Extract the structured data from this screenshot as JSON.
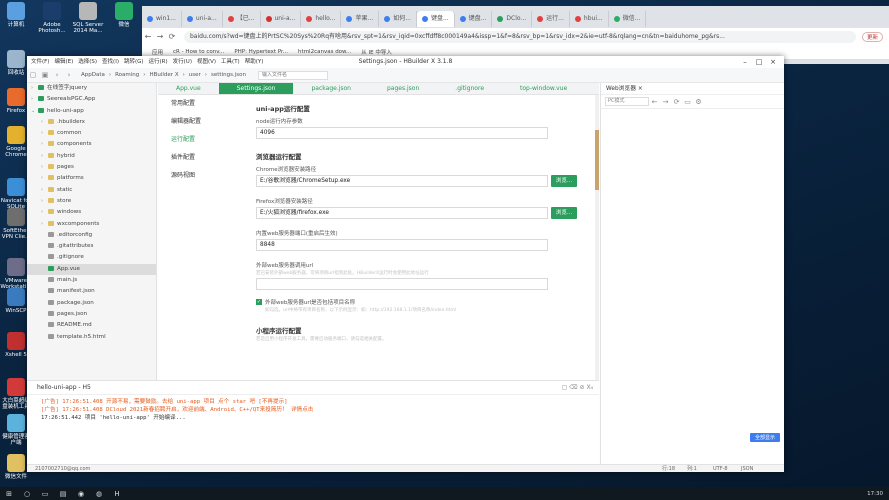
{
  "desktop_icons": [
    {
      "label": "计算机",
      "color": "#5aa0e0"
    },
    {
      "label": "Adobe Photosh...",
      "color": "#1b3d6b"
    },
    {
      "label": "SQL Server 2014 Ma...",
      "color": "#b7b7b7"
    },
    {
      "label": "微信",
      "color": "#2aae67"
    },
    {
      "label": "回收站",
      "color": "#9bb6cc"
    },
    {
      "label": "Firefox",
      "color": "#e86a2c"
    },
    {
      "label": "Google Chrome",
      "color": "#e3b12d"
    },
    {
      "label": "Navicat for SQLite",
      "color": "#3b8fd6"
    },
    {
      "label": "SoftEther VPN Clie...",
      "color": "#6e6e6e"
    },
    {
      "label": "VMware Workstati...",
      "color": "#6d6d8a"
    },
    {
      "label": "WinSCP",
      "color": "#3a7bbf"
    },
    {
      "label": "Xshell 5",
      "color": "#c03030"
    },
    {
      "label": "大白菜超级 盘装机工具",
      "color": "#d23a3a"
    },
    {
      "label": "健康管理客户端",
      "color": "#5bb3dd"
    },
    {
      "label": "微信文件",
      "color": "#e0c060"
    }
  ],
  "browser": {
    "tabs": [
      {
        "label": "win1...",
        "color": "#3d7df0"
      },
      {
        "label": "uni-a...",
        "color": "#3d7df0"
      },
      {
        "label": "【已...",
        "color": "#e04040"
      },
      {
        "label": "uni-a...",
        "color": "#d03030"
      },
      {
        "label": "hello...",
        "color": "#e04040"
      },
      {
        "label": "苹果...",
        "color": "#3d7df0"
      },
      {
        "label": "如何...",
        "color": "#3d7df0"
      },
      {
        "label": "键盘...",
        "color": "#3d7df0"
      },
      {
        "label": "键盘...",
        "color": "#3d7df0"
      },
      {
        "label": "DClo...",
        "color": "#2b9d5c"
      },
      {
        "label": "运行...",
        "color": "#e04040"
      },
      {
        "label": "hbui...",
        "color": "#e04040"
      },
      {
        "label": "微信...",
        "color": "#2aae67"
      }
    ],
    "url": "baidu.com/s?wd=键盘上的PrtSC%20Sys%20Rq有啥用&rsv_spt=1&rsv_iqid=0xcffdff8c000149a4&issp=1&f=8&rsv_bp=1&rsv_idx=2&ie=utf-8&rqlang=cn&tn=baiduhome_pg&rs...",
    "error_label": "更新",
    "bookmarks": [
      "应用",
      "cR - How to conv...",
      "PHP: Hypertext Pr...",
      "html2canvas dow...",
      "从 IE 中导入"
    ]
  },
  "hbuilder": {
    "title": "Settings.json - HBuilder X 3.1.8",
    "menu": [
      "文件(F)",
      "编辑(E)",
      "选择(S)",
      "查找(I)",
      "跳转(G)",
      "运行(R)",
      "发行(U)",
      "视图(V)",
      "工具(T)",
      "帮助(Y)"
    ],
    "breadcrumb": [
      "AppData",
      "Roaming",
      "HBuilder X",
      "user",
      "settings.json"
    ],
    "search_placeholder": "输入文件名",
    "tree": [
      {
        "label": "在线签字jquery",
        "arrow": "›",
        "color": "#2b9d5c"
      },
      {
        "label": "SeerealsPGC.App",
        "arrow": "›",
        "color": "#2b9d5c"
      },
      {
        "label": "hello-uni-app",
        "arrow": "⌄",
        "color": "#2b9d5c"
      },
      {
        "label": ".hbuilderx",
        "arrow": "›",
        "color": "#e0c060"
      },
      {
        "label": "common",
        "arrow": "›",
        "color": "#e0c060"
      },
      {
        "label": "components",
        "arrow": "›",
        "color": "#e0c060"
      },
      {
        "label": "hybrid",
        "arrow": "›",
        "color": "#e0c060"
      },
      {
        "label": "pages",
        "arrow": "›",
        "color": "#e0c060"
      },
      {
        "label": "platforms",
        "arrow": "›",
        "color": "#e0c060"
      },
      {
        "label": "static",
        "arrow": "›",
        "color": "#e0c060"
      },
      {
        "label": "store",
        "arrow": "›",
        "color": "#e0c060"
      },
      {
        "label": "windows",
        "arrow": "›",
        "color": "#e0c060"
      },
      {
        "label": "wxcomponents",
        "arrow": "›",
        "color": "#e0c060"
      },
      {
        "label": ".editorconfig",
        "arrow": "",
        "color": "#999999"
      },
      {
        "label": ".gitattributes",
        "arrow": "",
        "color": "#999999"
      },
      {
        "label": ".gitignore",
        "arrow": "",
        "color": "#999999"
      },
      {
        "label": "App.vue",
        "arrow": "",
        "color": "#2b9d5c"
      },
      {
        "label": "main.js",
        "arrow": "",
        "color": "#999999"
      },
      {
        "label": "manifest.json",
        "arrow": "",
        "color": "#999999"
      },
      {
        "label": "package.json",
        "arrow": "",
        "color": "#999999"
      },
      {
        "label": "pages.json",
        "arrow": "",
        "color": "#999999"
      },
      {
        "label": "README.md",
        "arrow": "",
        "color": "#999999"
      },
      {
        "label": "template.h5.html",
        "arrow": "",
        "color": "#999999"
      }
    ],
    "selected_tree_index": 16,
    "editor_tabs": [
      "App.vue",
      "Settings.json",
      "package.json",
      "pages.json",
      ".gitignore",
      "top-window.vue"
    ],
    "active_editor_tab": 1,
    "settings_nav": [
      "常用配置",
      "编辑器配置",
      "运行配置",
      "插件配置",
      "源码视图"
    ],
    "active_settings_nav": 2,
    "settings": {
      "app_section": "uni-app运行配置",
      "node_memory_label": "node运行内存参数",
      "node_memory_value": "4096",
      "browser_section": "浏览器运行配置",
      "chrome_label": "Chrome浏览器安装路径",
      "chrome_value": "E:/谷歌浏览器/ChromeSetup.exe",
      "firefox_label": "Firefox浏览器安装路径",
      "firefox_value": "E:/火狐浏览器/firefox.exe",
      "browse_label": "浏览...",
      "port_label": "内置web服务器端口(重启后生效)",
      "port_value": "8848",
      "external_label": "外部web服务器调用url",
      "external_hint": "若已安装外部web服务器，可将项目url指到此处。HBuilderX运行时会使用此地址运行",
      "external_value": "",
      "include_label": "外部web服务器url是否包括项目名称",
      "include_hint": "如勾选，url中将带有项目名称，以下示例显示：如：http://192.168.1.1/项目名称/index.html",
      "include_checked": true,
      "mini_section": "小程序运行配置",
      "mini_hint": "若是启用小程序开发工具，需要启动服务端口，请勾选相关配置。"
    },
    "preview": {
      "title": "Web浏览器",
      "device_select": "PC模式",
      "footer_button": "全部显示"
    },
    "console": {
      "title": "hello-uni-app - H5",
      "lines": [
        {
          "text": "[广告] 17:26:51.408 开源不易，需要鼓励。去给 uni-app 项目 点个 star 吧 [不再提示]",
          "color": "#e55a1c"
        },
        {
          "text": "[广告] 17:26:51.408 DCloud 2021新春招聘开启，欢迎前端、Android、C++/QT来投简历！ 详情点击",
          "color": "#e55a1c"
        },
        {
          "text": "17:26:51.442 项目 'hello-uni-app' 开始编译...",
          "color": "#333333"
        }
      ]
    },
    "status": {
      "account": "2107002710@qq.com",
      "position": "行:18",
      "column": "列:1",
      "encoding": "UTF-8",
      "language": "JSON"
    }
  },
  "taskbar": {
    "time": "17:30"
  }
}
